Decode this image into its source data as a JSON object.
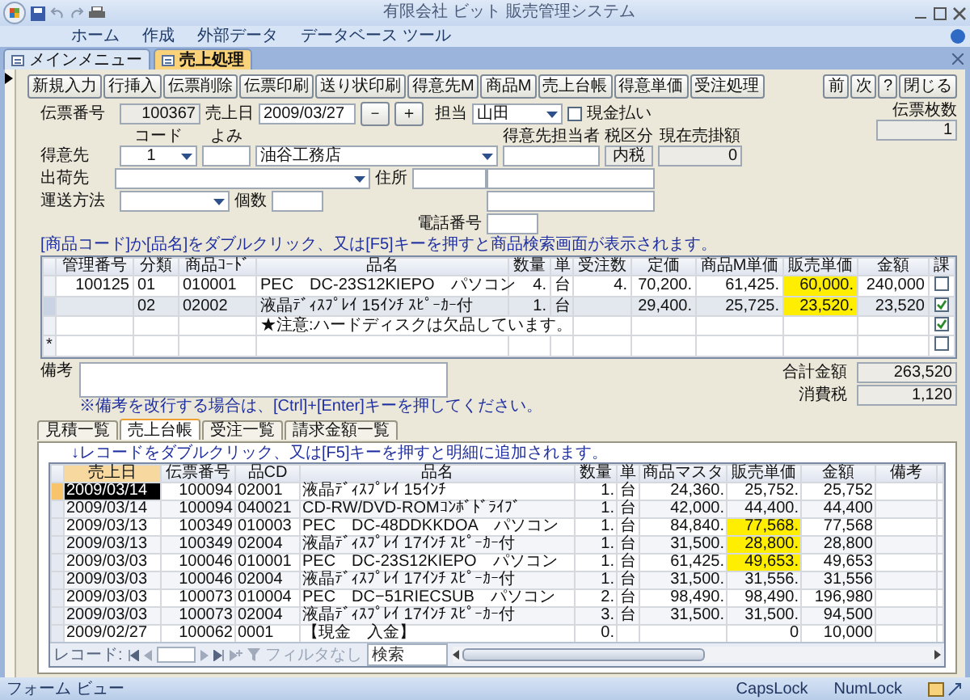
{
  "window": {
    "title": "有限会社 ビット 販売管理システム"
  },
  "ribbon_tabs": [
    "ホーム",
    "作成",
    "外部データ",
    "データベース ツール"
  ],
  "document_tabs": [
    {
      "label": "メインメニュー",
      "selected": false
    },
    {
      "label": "売上処理",
      "selected": true
    }
  ],
  "toolbar": {
    "left": [
      "新規入力",
      "行挿入",
      "伝票削除",
      "伝票印刷",
      "送り状印刷",
      "得意先M",
      "商品M",
      "売上台帳",
      "得意単価",
      "受注処理"
    ],
    "right": [
      "前",
      "次",
      "?",
      "閉じる"
    ]
  },
  "slip": {
    "number_label": "伝票番号",
    "number": "100367",
    "date_label": "売上日",
    "date": "2009/03/27",
    "minus": "－",
    "plus": "＋",
    "staff_label": "担当",
    "staff": "山田",
    "cash_label": "現金払い",
    "cash_checked": false,
    "count_label": "伝票枚数",
    "count": "1"
  },
  "customer": {
    "label": "得意先",
    "code_caption": "コード",
    "code": "1",
    "reading_caption": "よみ",
    "name": "油谷工務店",
    "contact_caption": "得意先担当者",
    "tax_caption": "税区分",
    "tax": "内税",
    "balance_caption": "現在売掛額",
    "balance": "0"
  },
  "shipping": {
    "label": "出荷先",
    "address_label": "住所",
    "method_label": "運送方法",
    "pieces_label": "個数",
    "phone_label": "電話番号"
  },
  "detail_hint": "[商品コード]か[品名]をダブルクリック、又は[F5]キーを押すと商品検索画面が表示されます。",
  "details": {
    "columns": [
      "管理番号",
      "分類",
      "商品ｺｰﾄﾞ",
      "品名",
      "数量",
      "単",
      "受注数",
      "定価",
      "商品M単価",
      "販売単価",
      "金額",
      "課"
    ],
    "rows": [
      {
        "kind": "item",
        "selected": false,
        "highlighted": true,
        "taxable": false,
        "cells": [
          "100125",
          "01",
          "010001",
          "PEC　DC-23S12KIEPO　パソコン",
          "4.",
          "台",
          "4.",
          "70,200.",
          "61,425.",
          "60,000.",
          "240,000"
        ]
      },
      {
        "kind": "item",
        "selected": true,
        "highlighted": true,
        "taxable": true,
        "cells": [
          null,
          "02",
          "02002",
          "液晶ﾃﾞｨｽﾌﾟﾚｲ 15ｲﾝﾁ ｽﾋﾟｰｶｰ付",
          "1.",
          "台",
          null,
          "29,400.",
          "25,725.",
          "23,520.",
          "23,520"
        ]
      },
      {
        "kind": "note",
        "selected": false,
        "highlighted": false,
        "taxable": true,
        "text": "★注意:ハードディスクは欠品しています。"
      },
      {
        "kind": "new",
        "selected": false,
        "highlighted": false,
        "taxable": false,
        "marker": "*"
      }
    ]
  },
  "remarks": {
    "label": "備考",
    "hint": "※備考を改行する場合は、[Ctrl]+[Enter]キーを押してください。"
  },
  "totals": [
    {
      "label": "合計金額",
      "value": "263,520"
    },
    {
      "label": "消費税",
      "value": "1,120"
    }
  ],
  "lower_tabs": [
    {
      "label": "見積一覧",
      "selected": false
    },
    {
      "label": "売上台帳",
      "selected": true
    },
    {
      "label": "受注一覧",
      "selected": false
    },
    {
      "label": "請求金額一覧",
      "selected": false
    }
  ],
  "lower_hint": "↓レコードをダブルクリック、又は[F5]キーを押すと明細に追加されます。",
  "ledger": {
    "columns": [
      "売上日",
      "伝票番号",
      "品CD",
      "品名",
      "数量",
      "単",
      "商品マスタ",
      "販売単価",
      "金額",
      "備考"
    ],
    "rows": [
      {
        "selected": true,
        "highlighted": false,
        "cells": [
          "2009/03/14",
          "100094",
          "02001",
          "液晶ﾃﾞｨｽﾌﾟﾚｲ 15ｲﾝﾁ",
          "1.",
          "台",
          "24,360.",
          "25,752.",
          "25,752"
        ]
      },
      {
        "selected": false,
        "highlighted": false,
        "cells": [
          "2009/03/14",
          "100094",
          "040021",
          "CD-RW/DVD-ROMｺﾝﾎﾞﾄﾞﾗｲﾌﾞ",
          "1.",
          "台",
          "42,000.",
          "44,400.",
          "44,400"
        ]
      },
      {
        "selected": false,
        "highlighted": true,
        "cells": [
          "2009/03/13",
          "100349",
          "010003",
          "PEC　DC-48DDKKDOA　パソコン",
          "1.",
          "台",
          "84,840.",
          "77,568.",
          "77,568"
        ]
      },
      {
        "selected": false,
        "highlighted": true,
        "cells": [
          "2009/03/13",
          "100349",
          "02004",
          "液晶ﾃﾞｨｽﾌﾟﾚｲ 17ｲﾝﾁ ｽﾋﾟｰｶｰ付",
          "1.",
          "台",
          "31,500.",
          "28,800.",
          "28,800"
        ]
      },
      {
        "selected": false,
        "highlighted": true,
        "cells": [
          "2009/03/03",
          "100046",
          "010001",
          "PEC　DC-23S12KIEPO　パソコン",
          "1.",
          "台",
          "61,425.",
          "49,653.",
          "49,653"
        ]
      },
      {
        "selected": false,
        "highlighted": false,
        "cells": [
          "2009/03/03",
          "100046",
          "02004",
          "液晶ﾃﾞｨｽﾌﾟﾚｲ 17ｲﾝﾁ ｽﾋﾟｰｶｰ付",
          "1.",
          "台",
          "31,500.",
          "31,556.",
          "31,556"
        ]
      },
      {
        "selected": false,
        "highlighted": false,
        "cells": [
          "2009/03/03",
          "100073",
          "010004",
          "PEC　DC−51RIECSUB　パソコン",
          "2.",
          "台",
          "98,490.",
          "98,490.",
          "196,980"
        ]
      },
      {
        "selected": false,
        "highlighted": false,
        "cells": [
          "2009/03/03",
          "100073",
          "02004",
          "液晶ﾃﾞｨｽﾌﾟﾚｲ 17ｲﾝﾁ ｽﾋﾟｰｶｰ付",
          "3.",
          "台",
          "31,500.",
          "31,500.",
          "94,500"
        ]
      },
      {
        "selected": false,
        "highlighted": false,
        "cells": [
          "2009/02/27",
          "100062",
          "0001",
          "【現金　入金】",
          "0.",
          null,
          null,
          "0",
          "10,000"
        ]
      }
    ]
  },
  "navigator": {
    "label": "レコード:",
    "filter": "フィルタなし",
    "search_placeholder": "検索"
  },
  "status_bar": {
    "mode": "フォーム ビュー",
    "indicators": [
      "CapsLock",
      "NumLock"
    ]
  }
}
